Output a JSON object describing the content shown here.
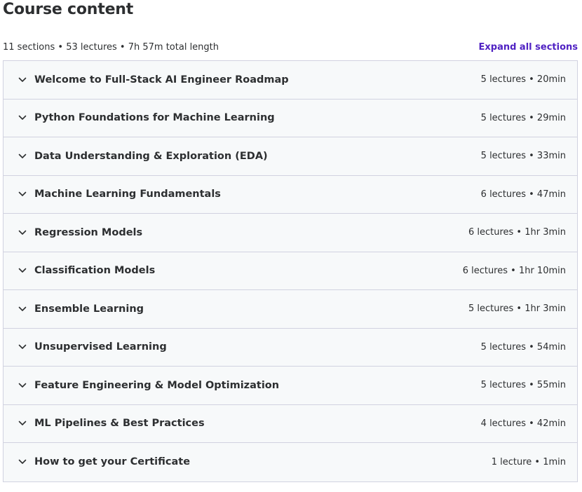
{
  "header": {
    "title": "Course content",
    "summary": "11 sections • 53 lectures • 7h 57m total length",
    "expand_all_label": "Expand all sections"
  },
  "colors": {
    "accent": "#5022c3",
    "section_bg": "#f7f9fa",
    "border": "#d1d2e0",
    "text": "#2d2f31"
  },
  "sections": [
    {
      "title": "Welcome to Full-Stack AI Engineer Roadmap",
      "meta": "5 lectures • 20min",
      "icon": "chevron-down-icon"
    },
    {
      "title": "Python Foundations for Machine Learning",
      "meta": "5 lectures • 29min",
      "icon": "chevron-down-icon"
    },
    {
      "title": "Data Understanding & Exploration (EDA)",
      "meta": "5 lectures • 33min",
      "icon": "chevron-down-icon"
    },
    {
      "title": "Machine Learning Fundamentals",
      "meta": "6 lectures • 47min",
      "icon": "chevron-down-icon"
    },
    {
      "title": "Regression Models",
      "meta": "6 lectures • 1hr 3min",
      "icon": "chevron-down-icon"
    },
    {
      "title": "Classification Models",
      "meta": "6 lectures • 1hr 10min",
      "icon": "chevron-down-icon"
    },
    {
      "title": "Ensemble Learning",
      "meta": "5 lectures • 1hr 3min",
      "icon": "chevron-down-icon"
    },
    {
      "title": "Unsupervised Learning",
      "meta": "5 lectures • 54min",
      "icon": "chevron-down-icon"
    },
    {
      "title": "Feature Engineering & Model Optimization",
      "meta": "5 lectures • 55min",
      "icon": "chevron-down-icon"
    },
    {
      "title": "ML Pipelines & Best Practices",
      "meta": "4 lectures • 42min",
      "icon": "chevron-down-icon"
    },
    {
      "title": "How to get your Certificate",
      "meta": "1 lecture • 1min",
      "icon": "chevron-down-icon"
    }
  ]
}
